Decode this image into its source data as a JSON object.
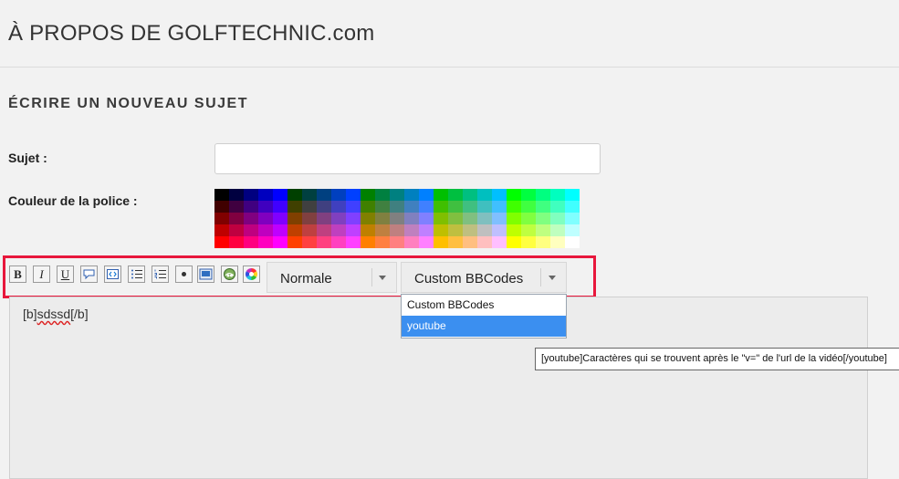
{
  "site_title": "À PROPOS DE GOLFTECHNIC.com",
  "section_title": "ÉCRIRE UN NOUVEAU SUJET",
  "form": {
    "subject_label": "Sujet :",
    "subject_value": "",
    "color_label": "Couleur de la police :"
  },
  "palette_colors": [
    "#000000",
    "#000040",
    "#000080",
    "#0000BF",
    "#0000FF",
    "#004000",
    "#004040",
    "#004080",
    "#0040BF",
    "#0040FF",
    "#008000",
    "#008040",
    "#008080",
    "#0080BF",
    "#0080FF",
    "#00BF00",
    "#00BF40",
    "#00BF80",
    "#00BFBF",
    "#00BFFF",
    "#00FF00",
    "#00FF40",
    "#00FF80",
    "#00FFBF",
    "#00FFFF",
    "#400000",
    "#400040",
    "#400080",
    "#4000BF",
    "#4000FF",
    "#404000",
    "#404040",
    "#404080",
    "#4040BF",
    "#4040FF",
    "#408000",
    "#408040",
    "#408080",
    "#4080BF",
    "#4080FF",
    "#40BF00",
    "#40BF40",
    "#40BF80",
    "#40BFBF",
    "#40BFFF",
    "#40FF00",
    "#40FF40",
    "#40FF80",
    "#40FFBF",
    "#40FFFF",
    "#800000",
    "#800040",
    "#800080",
    "#8000BF",
    "#8000FF",
    "#804000",
    "#804040",
    "#804080",
    "#8040BF",
    "#8040FF",
    "#808000",
    "#808040",
    "#808080",
    "#8080BF",
    "#8080FF",
    "#80BF00",
    "#80BF40",
    "#80BF80",
    "#80BFBF",
    "#80BFFF",
    "#80FF00",
    "#80FF40",
    "#80FF80",
    "#80FFBF",
    "#80FFFF",
    "#BF0000",
    "#BF0040",
    "#BF0080",
    "#BF00BF",
    "#BF00FF",
    "#BF4000",
    "#BF4040",
    "#BF4080",
    "#BF40BF",
    "#BF40FF",
    "#BF8000",
    "#BF8040",
    "#BF8080",
    "#BF80BF",
    "#BF80FF",
    "#BFBF00",
    "#BFBF40",
    "#BFBF80",
    "#BFBFBF",
    "#BFBFFF",
    "#BFFF00",
    "#BFFF40",
    "#BFFF80",
    "#BFFFBF",
    "#BFFFFF",
    "#FF0000",
    "#FF0040",
    "#FF0080",
    "#FF00BF",
    "#FF00FF",
    "#FF4000",
    "#FF4040",
    "#FF4080",
    "#FF40BF",
    "#FF40FF",
    "#FF8000",
    "#FF8040",
    "#FF8080",
    "#FF80BF",
    "#FF80FF",
    "#FFBF00",
    "#FFBF40",
    "#FFBF80",
    "#FFBFBF",
    "#FFBFFF",
    "#FFFF00",
    "#FFFF40",
    "#FFFF80",
    "#FFFFBF",
    "#FFFFFF"
  ],
  "toolbar": {
    "buttons": [
      {
        "name": "bold-button",
        "glyph": "B"
      },
      {
        "name": "italic-button",
        "glyph": "I"
      },
      {
        "name": "underline-button",
        "glyph": "U"
      },
      {
        "name": "quote-button",
        "icon": "speech-bubble-icon"
      },
      {
        "name": "code-button",
        "icon": "code-icon"
      },
      {
        "name": "bullet-list-button",
        "icon": "bullet-list-icon"
      },
      {
        "name": "numbered-list-button",
        "icon": "numbered-list-icon"
      },
      {
        "name": "list-item-button",
        "icon": "bullet-icon"
      },
      {
        "name": "image-button",
        "icon": "image-icon"
      },
      {
        "name": "link-button",
        "icon": "globe-icon"
      },
      {
        "name": "color-button",
        "icon": "color-wheel-icon"
      }
    ],
    "font_size_select": "Normale",
    "bbcode_select": "Custom BBCodes",
    "bbcode_options": [
      "Custom BBCodes",
      "youtube"
    ],
    "bbcode_selected_index": 1,
    "highlight_color": "#e8173c"
  },
  "editor": {
    "content_pre": "[b]",
    "content_word": "sdssd",
    "content_post": "[/b]"
  },
  "tooltip": "[youtube]Caractères qui se trouvent après le \"v=\" de l'url de la vidéo[/youtube]"
}
